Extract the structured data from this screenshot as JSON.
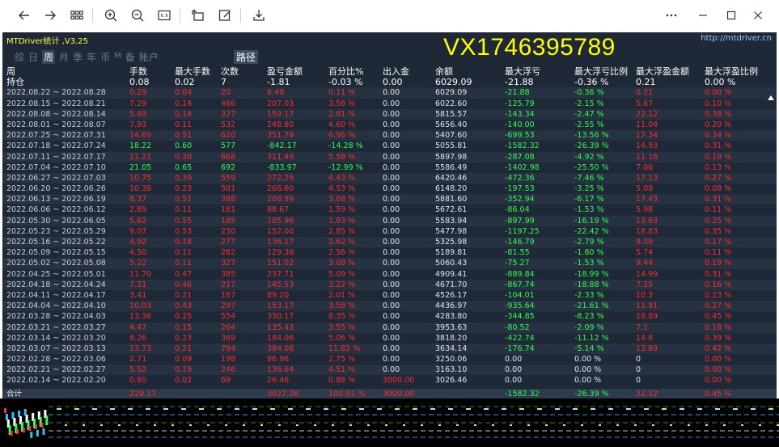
{
  "app": {
    "title": "MTDriver统计 ,V3.25",
    "url": "http://mtdriver.cn",
    "watermark": "VX1746395789"
  },
  "tabs": [
    {
      "label": "综",
      "active": false,
      "small": false
    },
    {
      "label": "日",
      "active": false,
      "small": false
    },
    {
      "label": "周",
      "active": true,
      "small": false
    },
    {
      "label": "月",
      "active": false,
      "small": false
    },
    {
      "label": "季",
      "active": false,
      "small": false
    },
    {
      "label": "年",
      "active": false,
      "small": false
    },
    {
      "label": "币",
      "active": false,
      "small": false
    },
    {
      "label": "M",
      "active": false,
      "small": true
    },
    {
      "label": "备",
      "active": false,
      "small": false
    },
    {
      "label": "账户",
      "active": false,
      "small": false
    }
  ],
  "route_label": "路径",
  "headers": [
    "周",
    "手数",
    "最大手数",
    "次数",
    "盈亏金额",
    "百分比%",
    "出入金",
    "余额",
    "最大浮亏",
    "最大浮亏比例",
    "最大浮盈金额",
    "最大浮盈比例"
  ],
  "holding": {
    "label": "持仓",
    "cells": [
      "0.08",
      "0.02",
      "7",
      "-1.81",
      "-0.03 %",
      "0.00",
      "6029.09",
      "-21.88",
      "-0.36 %",
      "0.21",
      "0.00 %"
    ],
    "colors": [
      "g",
      "g",
      "g",
      "g",
      "g",
      "w",
      "w",
      "r",
      "g",
      "r",
      "r"
    ]
  },
  "rows": [
    [
      "2022.08.22 ~ 2022.08.28",
      "0.29",
      "0.04",
      "20",
      "6.49",
      "0.11 %",
      "0.00",
      "6029.09",
      "-21.88",
      "-0.36 %",
      "0.21",
      "0.00 %"
    ],
    [
      "2022.08.15 ~ 2022.08.21",
      "7.29",
      "0.14",
      "466",
      "207.03",
      "3.56 %",
      "0.00",
      "6022.60",
      "-125.79",
      "-2.15 %",
      "5.67",
      "0.10 %"
    ],
    [
      "2022.08.08 ~ 2022.08.14",
      "5.49",
      "0.14",
      "327",
      "159.17",
      "2.81 %",
      "0.00",
      "5815.57",
      "-143.34",
      "-2.47 %",
      "22.12",
      "0.38 %"
    ],
    [
      "2022.08.01 ~ 2022.08.07",
      "7.93",
      "0.11",
      "532",
      "248.80",
      "4.60 %",
      "0.00",
      "5656.40",
      "-140.00",
      "-2.55 %",
      "11.04",
      "0.20 %"
    ],
    [
      "2022.07.25 ~ 2022.07.31",
      "14.69",
      "0.51",
      "620",
      "351.79",
      "6.96 %",
      "0.00",
      "5407.60",
      "-699.53",
      "-13.56 %",
      "17.34",
      "0.34 %"
    ],
    [
      "2022.07.18 ~ 2022.07.24",
      "18.22",
      "0.60",
      "577",
      "-842.17",
      "-14.28 %",
      "0.00",
      "5055.81",
      "-1582.32",
      "-26.39 %",
      "14.93",
      "0.31 %"
    ],
    [
      "2022.07.11 ~ 2022.07.17",
      "11.21",
      "0.30",
      "668",
      "311.49",
      "5.58 %",
      "0.00",
      "5897.98",
      "-287.08",
      "-4.92 %",
      "11.16",
      "0.19 %"
    ],
    [
      "2022.07.04 ~ 2022.07.10",
      "21.05",
      "0.65",
      "692",
      "-833.97",
      "-12.99 %",
      "0.00",
      "5586.49",
      "-1402.98",
      "-25.50 %",
      "7.06",
      "0.13 %"
    ],
    [
      "2022.06.27 ~ 2022.07.03",
      "10.75",
      "0.39",
      "559",
      "272.26",
      "4.43 %",
      "0.00",
      "6420.46",
      "-472.36",
      "-7.46 %",
      "17.13",
      "0.27 %"
    ],
    [
      "2022.06.20 ~ 2022.06.26",
      "10.38",
      "0.23",
      "501",
      "266.60",
      "4.53 %",
      "0.00",
      "6148.20",
      "-197.53",
      "-3.25 %",
      "5.09",
      "0.08 %"
    ],
    [
      "2022.06.13 ~ 2022.06.19",
      "8.37",
      "0.51",
      "388",
      "208.99",
      "3.68 %",
      "0.00",
      "5881.60",
      "-352.94",
      "-6.17 %",
      "17.43",
      "0.31 %"
    ],
    [
      "2022.06.06 ~ 2022.06.12",
      "2.89",
      "0.11",
      "181",
      "88.67",
      "1.59 %",
      "0.00",
      "5672.61",
      "-86.04",
      "-1.53 %",
      "5.98",
      "0.11 %"
    ],
    [
      "2022.05.30 ~ 2022.06.05",
      "5.62",
      "0.55",
      "185",
      "105.96",
      "1.93 %",
      "0.00",
      "5583.94",
      "-897.99",
      "-16.19 %",
      "13.63",
      "0.25 %"
    ],
    [
      "2022.05.23 ~ 2022.05.29",
      "9.07",
      "0.53",
      "230",
      "152.00",
      "2.85 %",
      "0.00",
      "5477.98",
      "-1197.25",
      "-22.42 %",
      "18.83",
      "0.35 %"
    ],
    [
      "2022.05.16 ~ 2022.05.22",
      "4.92",
      "0.18",
      "277",
      "136.17",
      "2.62 %",
      "0.00",
      "5325.98",
      "-146.79",
      "-2.79 %",
      "9.09",
      "0.17 %"
    ],
    [
      "2022.05.09 ~ 2022.05.15",
      "4.50",
      "0.11",
      "282",
      "129.38",
      "2.56 %",
      "0.00",
      "5189.81",
      "-81.55",
      "-1.60 %",
      "5.74",
      "0.11 %"
    ],
    [
      "2022.05.02 ~ 2022.05.08",
      "5.22",
      "0.11",
      "327",
      "151.02",
      "3.08 %",
      "0.00",
      "5060.43",
      "-75.27",
      "-1.53 %",
      "9.44",
      "0.19 %"
    ],
    [
      "2022.04.25 ~ 2022.05.01",
      "11.70",
      "0.47",
      "385",
      "237.71",
      "5.09 %",
      "0.00",
      "4909.41",
      "-889.84",
      "-18.99 %",
      "14.99",
      "0.31 %"
    ],
    [
      "2022.04.18 ~ 2022.04.24",
      "7.21",
      "0.46",
      "217",
      "145.53",
      "3.22 %",
      "0.00",
      "4671.70",
      "-867.74",
      "-18.88 %",
      "7.25",
      "0.16 %"
    ],
    [
      "2022.04.11 ~ 2022.04.17",
      "3.41",
      "0.21",
      "167",
      "89.20",
      "2.01 %",
      "0.00",
      "4526.17",
      "-104.01",
      "-2.33 %",
      "10.3",
      "0.23 %"
    ],
    [
      "2022.04.04 ~ 2022.04.10",
      "10.03",
      "0.43",
      "297",
      "153.17",
      "3.58 %",
      "0.00",
      "4436.97",
      "-935.64",
      "-21.61 %",
      "11.91",
      "0.27 %"
    ],
    [
      "2022.03.28 ~ 2022.04.03",
      "13.36",
      "0.25",
      "554",
      "330.17",
      "8.35 %",
      "0.00",
      "4283.80",
      "-344.85",
      "-8.23 %",
      "18.89",
      "0.45 %"
    ],
    [
      "2022.03.21 ~ 2022.03.27",
      "4.47",
      "0.15",
      "264",
      "135.43",
      "3.55 %",
      "0.00",
      "3953.63",
      "-80.52",
      "-2.09 %",
      "7.1",
      "0.18 %"
    ],
    [
      "2022.03.14 ~ 2022.03.20",
      "8.26",
      "0.23",
      "369",
      "184.06",
      "5.06 %",
      "0.00",
      "3818.20",
      "-422.74",
      "-11.12 %",
      "14.8",
      "0.39 %"
    ],
    [
      "2022.03.07 ~ 2022.03.13",
      "13.73",
      "0.21",
      "794",
      "384.08",
      "11.82 %",
      "0.00",
      "3634.14",
      "-176.74",
      "-5.14 %",
      "13.89",
      "0.42 %"
    ],
    [
      "2022.02.28 ~ 2022.03.06",
      "2.71",
      "0.09",
      "198",
      "86.96",
      "2.75 %",
      "0.00",
      "3250.06",
      "0.00",
      "0.00 %",
      "0",
      "0.00 %"
    ],
    [
      "2022.02.21 ~ 2022.02.27",
      "5.52",
      "0.19",
      "246",
      "136.64",
      "4.51 %",
      "0.00",
      "3163.10",
      "0.00",
      "0.00 %",
      "0",
      "0.00 %"
    ],
    [
      "2022.02.14 ~ 2022.02.20",
      "0.80",
      "0.02",
      "69",
      "26.46",
      "0.88 %",
      "3000.00",
      "3026.46",
      "0.00",
      "0.00 %",
      "0",
      "0.00 %"
    ]
  ],
  "total": {
    "label": "合计",
    "cells": [
      "229.17",
      "",
      "",
      "3027.28",
      "100.91 %",
      "3000.00",
      "",
      "-1582.32",
      "-26.39 %",
      "22.12",
      "0.45 %"
    ],
    "colors": [
      "r",
      "r",
      "r",
      "r",
      "r",
      "r",
      "w",
      "g",
      "g",
      "r",
      "r"
    ]
  },
  "colors": {
    "panel_bg": "#1e2836",
    "profit_red": "#ff2b2b",
    "loss_green": "#2bff4a",
    "title_yellow": "#ffff44"
  }
}
